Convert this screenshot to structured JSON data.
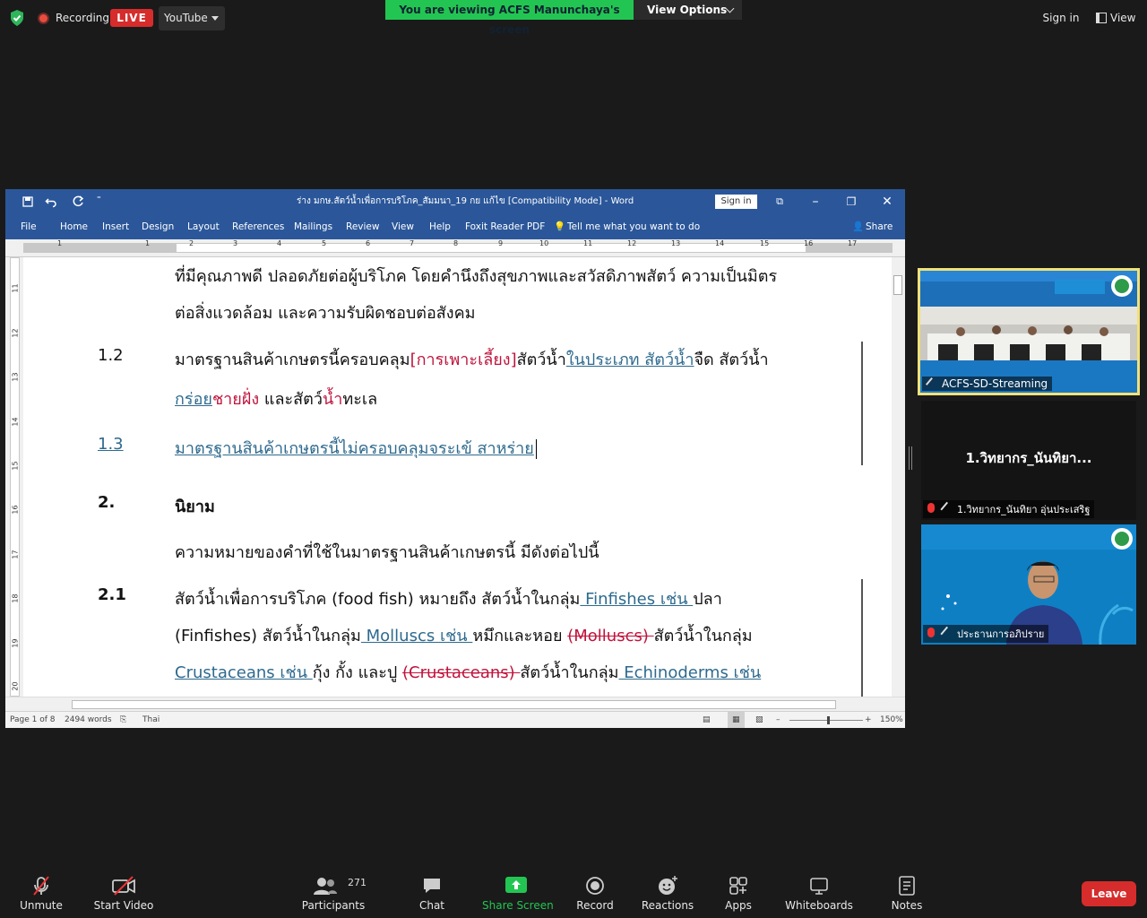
{
  "topbar": {
    "recording_label": "Recording",
    "live_label": "LIVE",
    "stream_platform": "YouTube",
    "viewing_banner": "You are viewing ACFS Manunchaya's screen",
    "view_options_label": "View Options",
    "sign_in_label": "Sign in",
    "view_label": "View"
  },
  "word": {
    "title": "ร่าง มกษ.สัตว์น้ำเพื่อการบริโภค_สัมมนา_19 กย แก้ไข [Compatibility Mode]  -  Word",
    "sign_in_label": "Sign in",
    "menu": {
      "file": "File",
      "home": "Home",
      "insert": "Insert",
      "design": "Design",
      "layout": "Layout",
      "references": "References",
      "mailings": "Mailings",
      "review": "Review",
      "view": "View",
      "help": "Help",
      "foxit": "Foxit Reader PDF",
      "tell_me": "Tell me what you want to do",
      "share": "Share"
    },
    "ruler_numbers": [
      "1",
      "1",
      "2",
      "3",
      "4",
      "5",
      "6",
      "7",
      "8",
      "9",
      "10",
      "11",
      "12",
      "13",
      "14",
      "15",
      "16",
      "17"
    ],
    "vruler_numbers": [
      "11",
      "12",
      "13",
      "14",
      "15",
      "16",
      "17",
      "18",
      "19",
      "20"
    ],
    "doc": {
      "line1": "ที่มีคุณภาพดี ปลอดภัยต่อผู้บริโภค โดยคำนึงถึงสุขภาพและสวัสดิภาพสัตว์ ความเป็นมิตร",
      "line2": "ต่อสิ่งแวดล้อม และความรับผิดชอบต่อสังคม",
      "s12_num": "1.2",
      "s12_a": "มาตรฐานสินค้าเกษตรนี้ครอบคลุม",
      "s12_b": "[การเพาะเลี้ยง]",
      "s12_c": "สัตว์น้ำ",
      "s12_d": "ในประเภท สัตว์น้ำ",
      "s12_e": "จืด สัตว์น้ำ",
      "s12_f": "กร่อย",
      "s12_g": "ชายฝั่ง",
      "s12_h": " และสัตว์",
      "s12_i": "น้ำ",
      "s12_j": "ทะเล",
      "s13_num": "1.3",
      "s13_text": "มาตรฐานสินค้าเกษตรนี้ไม่ครอบคลุมจระเข้ สาหร่าย",
      "s2_num": "2.",
      "s2_title": "นิยาม",
      "s2_intro": "ความหมายของคำที่ใช้ในมาตรฐานสินค้าเกษตรนี้ มีดังต่อไปนี้",
      "s21_num": "2.1",
      "s21_a": "สัตว์น้ำเพื่อการบริโภค (food fish) หมายถึง สัตว์น้ำในกลุ่ม",
      "s21_b": " Finfishes เช่น ",
      "s21_c": "ปลา",
      "s21_d": "(Finfishes) สัตว์น้ำในกลุ่ม",
      "s21_e": " Molluscs เช่น ",
      "s21_f": "หมึกและหอย ",
      "s21_g": "(Molluscs) ",
      "s21_h": "สัตว์น้ำในกลุ่ม",
      "s21_i": "Crustaceans เช่น ",
      "s21_j": "กุ้ง กั้ง และปู ",
      "s21_k": "(Crustaceans) ",
      "s21_l": "สัตว์น้ำในกลุ่ม",
      "s21_m": " Echinoderms เช่น"
    },
    "status": {
      "page": "Page 1 of 8",
      "words": "2494 words",
      "language": "Thai",
      "zoom": "150%"
    }
  },
  "participants_panel": {
    "tile1_name": "ACFS-SD-Streaming",
    "tile2_display": "1.วิทยากร_นันทิยา...",
    "tile2_name": "1.วิทยากร_นันทิยา อุ่นประเสริฐ",
    "tile3_name": "ประธานการอภิปราย"
  },
  "toolbar": {
    "unmute": "Unmute",
    "start_video": "Start Video",
    "participants_count": "271",
    "participants": "Participants",
    "chat": "Chat",
    "share_screen": "Share Screen",
    "record": "Record",
    "reactions": "Reactions",
    "apps": "Apps",
    "whiteboards": "Whiteboards",
    "notes": "Notes",
    "leave": "Leave"
  },
  "colors": {
    "word_blue": "#2b579a",
    "zoom_green": "#23c552",
    "live_red": "#d62c2c",
    "tracked_insert": "#2e6a8e",
    "tracked_delete": "#c0143c"
  }
}
